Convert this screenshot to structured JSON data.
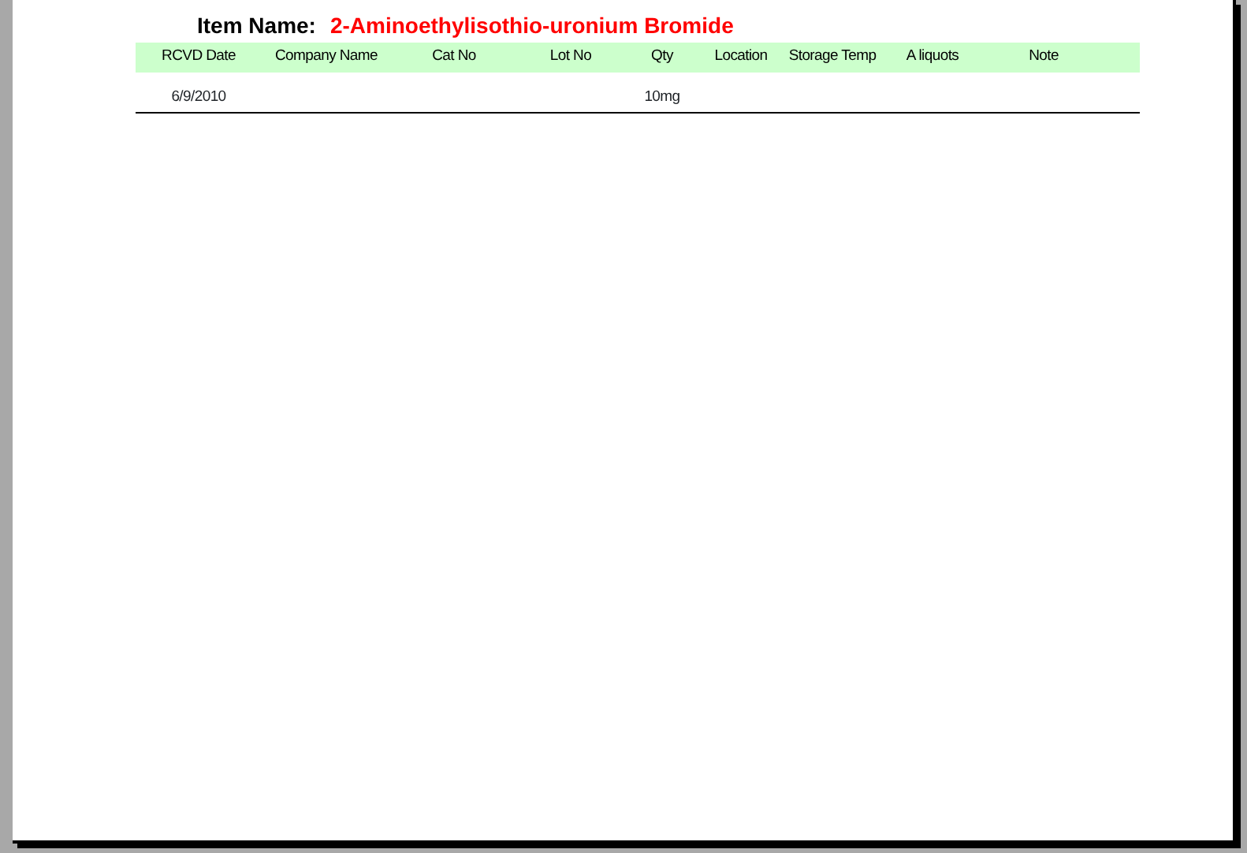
{
  "report": {
    "item_label": "Item Name:",
    "item_name": "2-Aminoethylisothio-uronium Bromide",
    "columns": [
      "RCVD Date",
      "Company Name",
      "Cat No",
      "Lot No",
      "Qty",
      "Location",
      "Storage Temp",
      "A liquots",
      "Note"
    ],
    "rows": [
      {
        "cells": [
          "6/9/2010",
          null,
          null,
          null,
          "10mg",
          null,
          null,
          null,
          null
        ]
      }
    ]
  }
}
